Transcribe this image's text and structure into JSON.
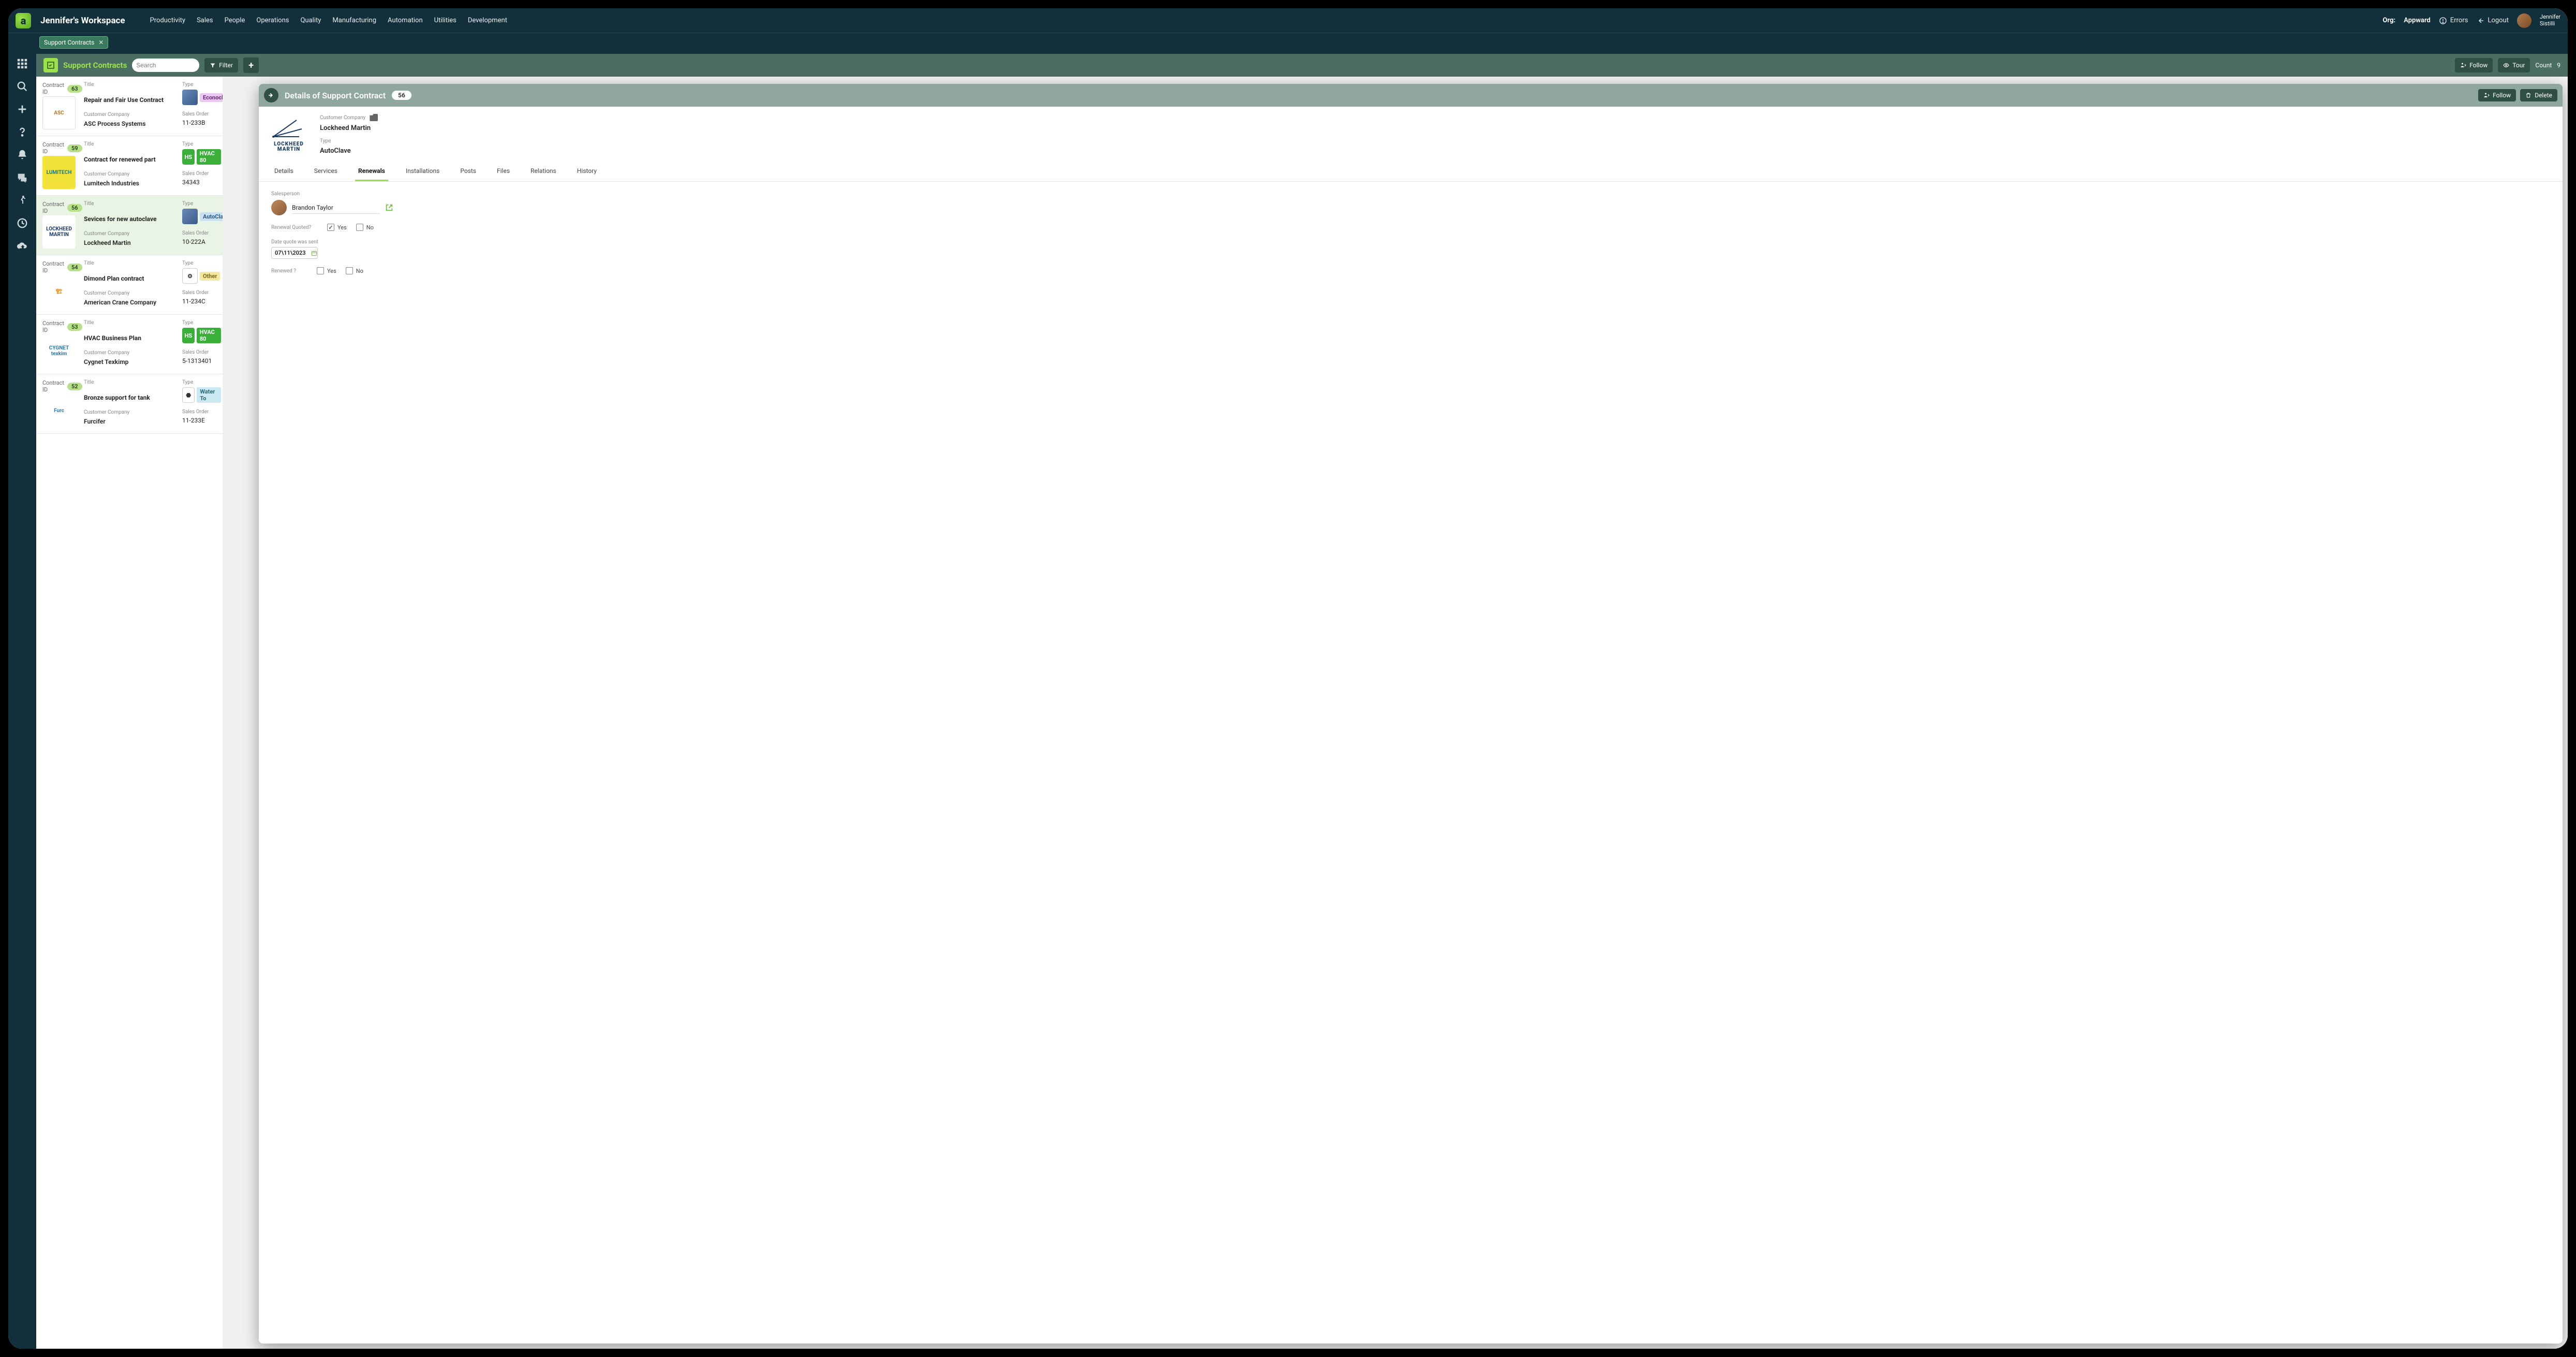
{
  "workspace_title": "Jennifer's Workspace",
  "topnav": [
    "Productivity",
    "Sales",
    "People",
    "Operations",
    "Quality",
    "Manufacturing",
    "Automation",
    "Utilities",
    "Development"
  ],
  "org_label": "Org:",
  "org_name": "Appward",
  "errors_label": "Errors",
  "logout_label": "Logout",
  "user": {
    "first": "Jennifer",
    "last": "Sistilli"
  },
  "breadcrumb": {
    "label": "Support Contracts"
  },
  "module": {
    "title": "Support Contracts",
    "search_placeholder": "Search",
    "filter_label": "Filter",
    "follow_label": "Follow",
    "tour_label": "Tour",
    "count_label": "Count",
    "count_value": "9"
  },
  "list": [
    {
      "id": "63",
      "title": "Repair and Fair Use Contract",
      "company": "ASC Process Systems",
      "type_chip": "Econoclo",
      "type_chip_class": "chip-econ",
      "type_icon_class": "ti-img",
      "type_icon_text": "",
      "sales_order": "11-233B",
      "logo_class": "lg-asc",
      "logo_text": "ASC"
    },
    {
      "id": "59",
      "title": "Contract for renewed part",
      "company": "Lumitech Industries",
      "type_chip": "HVAC 80",
      "type_chip_class": "chip-hvac",
      "type_icon_class": "ti-green",
      "type_icon_text": "HS",
      "sales_order": "34343",
      "logo_class": "lg-lum",
      "logo_text": "LUMITECH"
    },
    {
      "id": "56",
      "title": "Sevices for new autoclave",
      "company": "Lockheed Martin",
      "type_chip": "AutoClav",
      "type_chip_class": "chip-auto",
      "type_icon_class": "ti-img",
      "type_icon_text": "",
      "sales_order": "10-222A",
      "logo_class": "lg-lock",
      "logo_text": "LOCKHEED MARTIN",
      "selected": true
    },
    {
      "id": "54",
      "title": "Dimond Plan contract",
      "company": "American Crane Company",
      "type_chip": "Other",
      "type_chip_class": "chip-other",
      "type_icon_class": "ti-out",
      "type_icon_text": "⚙",
      "sales_order": "11-234C",
      "logo_class": "lg-crane",
      "logo_text": "🏗"
    },
    {
      "id": "53",
      "title": "HVAC Business Plan",
      "company": "Cygnet Texkimp",
      "type_chip": "HVAC 80",
      "type_chip_class": "chip-hvac",
      "type_icon_class": "ti-green",
      "type_icon_text": "HS",
      "sales_order": "5-1313401",
      "logo_class": "lg-cyg",
      "logo_text": "CYGNET texkim"
    },
    {
      "id": "52",
      "title": "Bronze support for tank",
      "company": "Furcifer",
      "type_chip": "Water To",
      "type_chip_class": "chip-water",
      "type_icon_class": "ti-out",
      "type_icon_text": "⬣",
      "sales_order": "11-233E",
      "logo_class": "lg-fur",
      "logo_text": "Furc"
    }
  ],
  "list_labels": {
    "contract_id": "Contract ID",
    "title": "Title",
    "customer_company": "Customer Company",
    "type": "Type",
    "sales_order": "Sales Order"
  },
  "detail": {
    "header_title": "Details of Support Contract",
    "id": "56",
    "follow_label": "Follow",
    "delete_label": "Delete",
    "customer_company_label": "Customer Company",
    "customer_company": "Lockheed Martin",
    "type_label": "Type",
    "type": "AutoClave",
    "tabs": [
      "Details",
      "Services",
      "Renewals",
      "Installations",
      "Posts",
      "Files",
      "Relations",
      "History"
    ],
    "active_tab": "Renewals",
    "renewals": {
      "salesperson_label": "Salesperson",
      "salesperson": "Brandon Taylor",
      "renewal_quoted_label": "Renewal Quoted?",
      "yes": "Yes",
      "no": "No",
      "quoted_yes_checked": true,
      "date_quote_label": "Date quote was sent",
      "date_quote": "07\\11\\2023",
      "renewed_label": "Renewed ?",
      "renewed_yes_checked": false,
      "renewed_no_checked": false
    }
  }
}
